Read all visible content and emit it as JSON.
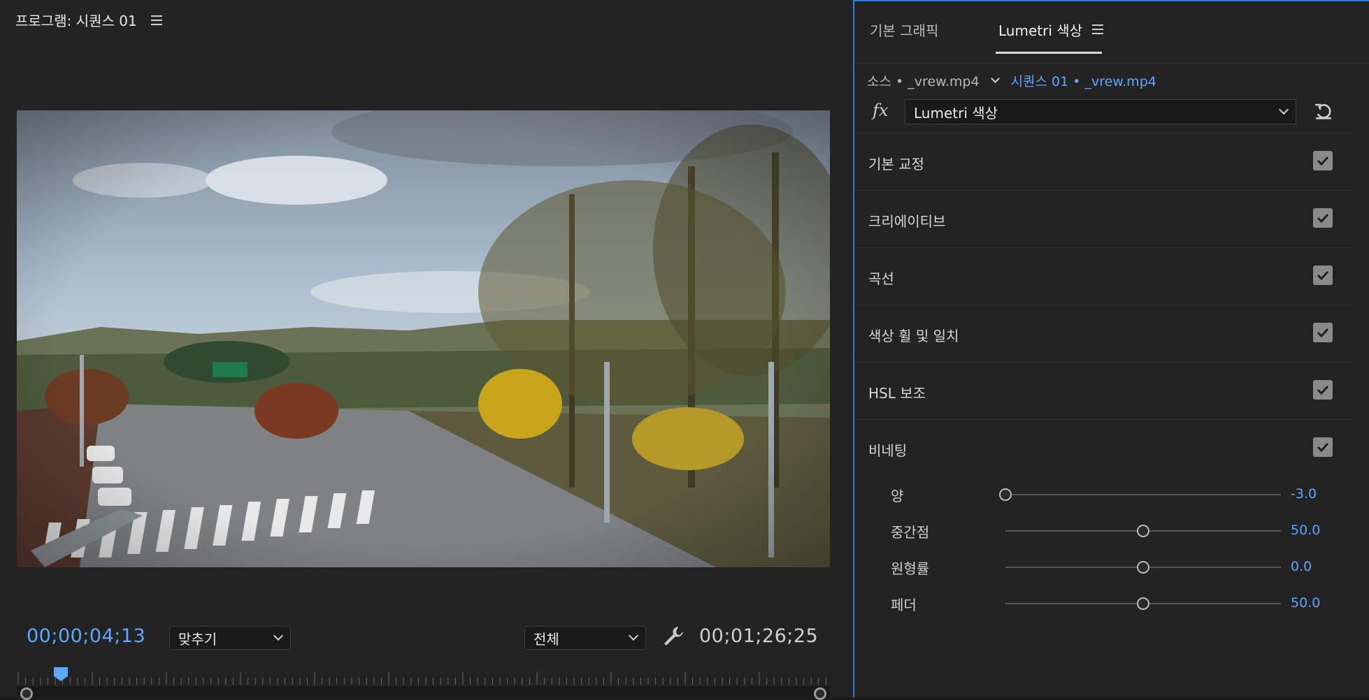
{
  "program_monitor": {
    "title": "프로그램: 시퀀스 01",
    "current_timecode": "00;00;04;13",
    "duration_timecode": "00;01;26;25",
    "zoom_select": "맞추기",
    "resolution_select": "전체",
    "playhead_fraction": 0.054
  },
  "panel": {
    "tabs": [
      {
        "label": "기본 그래픽"
      },
      {
        "label": "Lumetri 색상"
      }
    ],
    "source_label": "소스 • _vrew.mp4",
    "sequence_label": "시퀀스 01 • _vrew.mp4",
    "fx_label": "fx",
    "effect_select": "Lumetri 색상",
    "sections": [
      {
        "label": "기본 교정",
        "checked": true
      },
      {
        "label": "크리에이티브",
        "checked": true
      },
      {
        "label": "곡선",
        "checked": true
      },
      {
        "label": "색상 휠 및 일치",
        "checked": true
      },
      {
        "label": "HSL 보조",
        "checked": true
      },
      {
        "label": "비네팅",
        "checked": true
      }
    ],
    "vignette_sliders": [
      {
        "label": "양",
        "value": "-3.0",
        "fraction": 0.0
      },
      {
        "label": "중간점",
        "value": "50.0",
        "fraction": 0.5
      },
      {
        "label": "원형률",
        "value": "0.0",
        "fraction": 0.5
      },
      {
        "label": "페더",
        "value": "50.0",
        "fraction": 0.5
      }
    ]
  },
  "colors": {
    "accent": "#5fa6ff",
    "panel_border": "#2b7fd8",
    "background": "#232323"
  }
}
